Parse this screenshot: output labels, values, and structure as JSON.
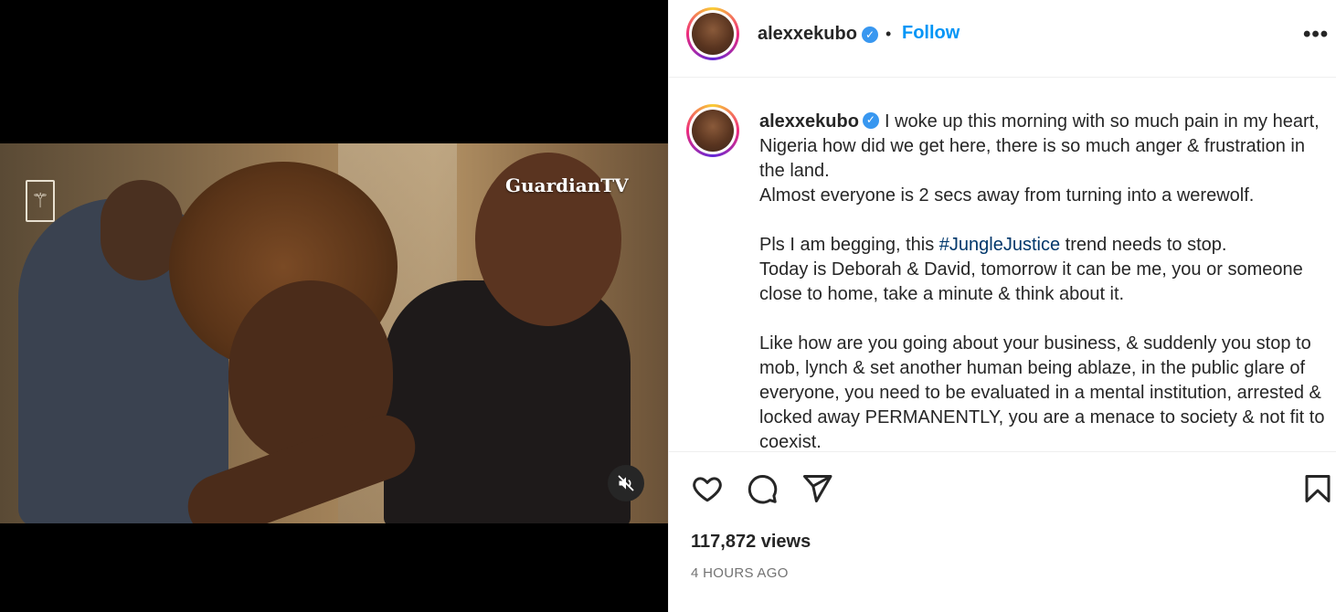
{
  "media": {
    "watermark": "GuardianTV",
    "logo_glyph": "⚚",
    "mute_icon": "speaker-muted-icon"
  },
  "header": {
    "username": "alexxekubo",
    "verified_glyph": "✓",
    "separator": "•",
    "follow_label": "Follow",
    "more_label": "•••"
  },
  "caption": {
    "username": "alexxekubo",
    "verified_glyph": "✓",
    "line1": "I woke up this morning with so much pain in my heart, Nigeria how did we get here, there is so much anger & frustration in the land.",
    "line2": "Almost everyone is 2 secs away from turning into a werewolf.",
    "para2_pre": "Pls I am begging, this ",
    "hashtag": "#JungleJustice",
    "para2_post": " trend needs to stop.",
    "para2_line2": "Today is Deborah & David, tomorrow it can be me, you or someone close to home, take a minute & think about it.",
    "para3": "Like how are you going about your business, & suddenly you stop to mob, lynch & set another human being ablaze, in the public glare of everyone, you need to be evaluated in a mental institution, arrested & locked away PERMANENTLY, you are a menace to society & not fit to coexist."
  },
  "actions": {
    "like_icon": "heart-icon",
    "comment_icon": "comment-icon",
    "share_icon": "share-icon",
    "save_icon": "bookmark-icon",
    "views": "117,872 views",
    "time": "4 HOURS AGO"
  },
  "colors": {
    "accent": "#0095f6",
    "verified": "#3897f0",
    "hashtag": "#00376b",
    "muted_text": "#737373"
  }
}
